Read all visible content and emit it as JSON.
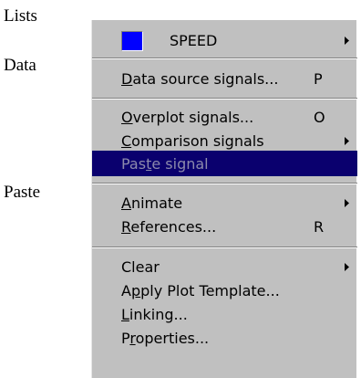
{
  "background_labels": {
    "lists": "Lists",
    "data": "Data",
    "paste": "Paste"
  },
  "menu": {
    "signal": {
      "label": "SPEED",
      "color": "#0000ff"
    },
    "items": [
      {
        "id": "data-source-signals",
        "label": "Data source signals...",
        "mnemonic": "D",
        "shortcut": "P"
      },
      {
        "id": "overplot-signals",
        "label": "Overplot signals...",
        "mnemonic": "O",
        "shortcut": "O"
      },
      {
        "id": "comparison-signals",
        "label": "Comparison signals",
        "mnemonic": "C",
        "submenu": true
      },
      {
        "id": "paste-signal",
        "label": "Paste signal",
        "mnemonic": "t",
        "highlighted": true,
        "disabled": true
      },
      {
        "id": "animate",
        "label": "Animate",
        "mnemonic": "A",
        "submenu": true
      },
      {
        "id": "references",
        "label": "References...",
        "mnemonic": "R",
        "shortcut": "R"
      },
      {
        "id": "clear",
        "label": "Clear",
        "submenu": true
      },
      {
        "id": "apply-plot-template",
        "label": "Apply Plot Template...",
        "mnemonic": "p"
      },
      {
        "id": "linking",
        "label": "Linking...",
        "mnemonic": "L"
      },
      {
        "id": "properties",
        "label": "Properties...",
        "mnemonic": "r"
      }
    ]
  },
  "colors": {
    "menu_background": "#c0c0c0",
    "highlight_background": "#0a006e",
    "highlight_text": "#8c8aac"
  },
  "icons": {
    "submenu_arrow": "submenu-arrow-icon"
  }
}
